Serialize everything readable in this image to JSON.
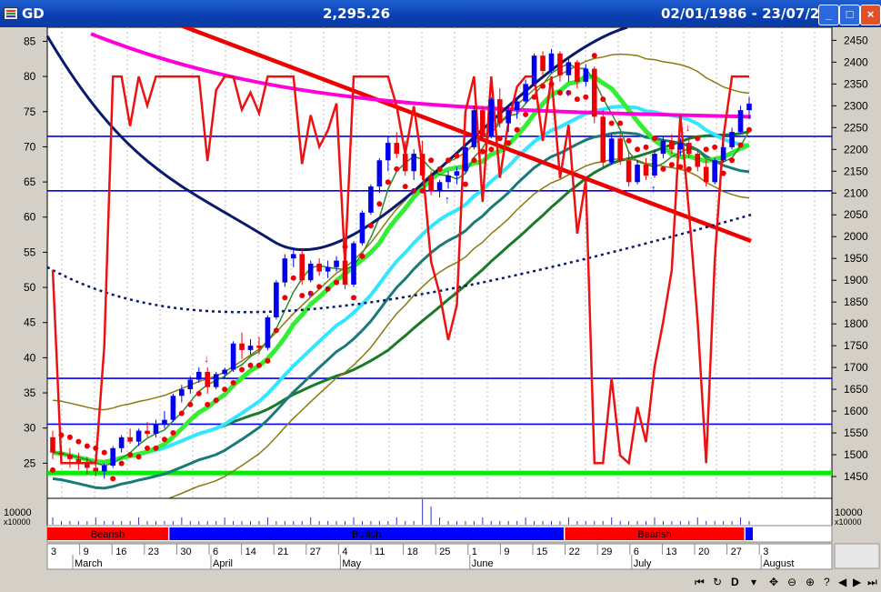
{
  "window": {
    "symbol": "GD",
    "last_value": "2,295.26",
    "date_range": "02/01/1986 - 23/07/2009",
    "controls": [
      "_",
      "□",
      "×"
    ]
  },
  "chart_data": {
    "type": "candlestick",
    "ylim_left": [
      20,
      87
    ],
    "ylim_right": [
      1400,
      2480
    ],
    "left_ticks": [
      "85",
      "80",
      "75",
      "70",
      "65",
      "60",
      "55",
      "50",
      "45",
      "40",
      "35",
      "30",
      "25"
    ],
    "right_ticks": [
      "2450",
      "2400",
      "2350",
      "2300",
      "2250",
      "2200",
      "2150",
      "2100",
      "2050",
      "2000",
      "1950",
      "1900",
      "1850",
      "1800",
      "1750",
      "1700",
      "1650",
      "1600",
      "1550",
      "1500",
      "1450"
    ],
    "volume": {
      "left_label": "10000",
      "right_label": "10000",
      "unit_label": "x10000"
    },
    "regime_bar": [
      {
        "label": "Bearish",
        "color": "#ff0000",
        "from_bar": 0,
        "to_bar": 14
      },
      {
        "label": "Bullish",
        "color": "#0000ff",
        "from_bar": 14,
        "to_bar": 60
      },
      {
        "label": "Bearish",
        "color": "#ff0000",
        "from_bar": 60,
        "to_bar": 81
      },
      {
        "label": "",
        "color": "#0000ff",
        "from_bar": 81,
        "to_bar": 82
      }
    ],
    "x_days": [
      "3",
      "9",
      "16",
      "23",
      "30",
      "6",
      "14",
      "21",
      "27",
      "4",
      "11",
      "18",
      "25",
      "1",
      "9",
      "15",
      "22",
      "29",
      "6",
      "13",
      "20",
      "27",
      "3"
    ],
    "months": [
      "March",
      "April",
      "May",
      "June",
      "July",
      "August"
    ],
    "first_day_label": "3",
    "horizontal_lines": [
      {
        "right_value": 2230,
        "color": "#0000ff"
      },
      {
        "right_value": 2105,
        "color": "#0000ff"
      },
      {
        "right_value": 1675,
        "color": "#0000ff"
      },
      {
        "right_value": 1570,
        "color": "#0000ff"
      },
      {
        "right_value": 1458,
        "color": "#00ee00"
      }
    ],
    "candles_right_axis": [
      [
        1540,
        1555,
        1490,
        1505
      ],
      [
        1505,
        1520,
        1480,
        1500
      ],
      [
        1500,
        1515,
        1470,
        1490
      ],
      [
        1490,
        1505,
        1465,
        1480
      ],
      [
        1480,
        1495,
        1455,
        1470
      ],
      [
        1470,
        1490,
        1450,
        1462
      ],
      [
        1462,
        1480,
        1445,
        1475
      ],
      [
        1475,
        1520,
        1470,
        1515
      ],
      [
        1515,
        1545,
        1505,
        1540
      ],
      [
        1540,
        1560,
        1525,
        1530
      ],
      [
        1530,
        1560,
        1520,
        1555
      ],
      [
        1555,
        1575,
        1540,
        1548
      ],
      [
        1548,
        1580,
        1540,
        1570
      ],
      [
        1570,
        1600,
        1560,
        1580
      ],
      [
        1580,
        1640,
        1575,
        1635
      ],
      [
        1635,
        1660,
        1620,
        1650
      ],
      [
        1650,
        1680,
        1640,
        1672
      ],
      [
        1672,
        1700,
        1665,
        1690
      ],
      [
        1690,
        1700,
        1640,
        1655
      ],
      [
        1655,
        1690,
        1650,
        1685
      ],
      [
        1685,
        1700,
        1675,
        1695
      ],
      [
        1695,
        1760,
        1690,
        1755
      ],
      [
        1755,
        1780,
        1720,
        1740
      ],
      [
        1740,
        1765,
        1730,
        1750
      ],
      [
        1750,
        1770,
        1730,
        1745
      ],
      [
        1745,
        1820,
        1740,
        1815
      ],
      [
        1815,
        1900,
        1810,
        1895
      ],
      [
        1895,
        1960,
        1885,
        1950
      ],
      [
        1950,
        1975,
        1930,
        1960
      ],
      [
        1960,
        1970,
        1890,
        1900
      ],
      [
        1900,
        1945,
        1895,
        1938
      ],
      [
        1938,
        1950,
        1910,
        1920
      ],
      [
        1920,
        1945,
        1905,
        1930
      ],
      [
        1930,
        1955,
        1920,
        1945
      ],
      [
        1945,
        1952,
        1880,
        1890
      ],
      [
        1890,
        1990,
        1885,
        1985
      ],
      [
        1985,
        2060,
        1980,
        2055
      ],
      [
        2055,
        2120,
        2050,
        2115
      ],
      [
        2115,
        2180,
        2100,
        2175
      ],
      [
        2175,
        2230,
        2150,
        2215
      ],
      [
        2215,
        2240,
        2180,
        2190
      ],
      [
        2190,
        2220,
        2140,
        2150
      ],
      [
        2150,
        2200,
        2130,
        2190
      ],
      [
        2190,
        2220,
        2130,
        2140
      ],
      [
        2140,
        2150,
        2095,
        2105
      ],
      [
        2105,
        2130,
        2090,
        2125
      ],
      [
        2125,
        2150,
        2110,
        2140
      ],
      [
        2140,
        2160,
        2120,
        2150
      ],
      [
        2150,
        2210,
        2145,
        2205
      ],
      [
        2205,
        2300,
        2200,
        2290
      ],
      [
        2290,
        2300,
        2220,
        2230
      ],
      [
        2230,
        2320,
        2225,
        2315
      ],
      [
        2315,
        2340,
        2250,
        2260
      ],
      [
        2260,
        2300,
        2240,
        2290
      ],
      [
        2290,
        2320,
        2270,
        2310
      ],
      [
        2310,
        2360,
        2305,
        2350
      ],
      [
        2350,
        2420,
        2345,
        2415
      ],
      [
        2415,
        2425,
        2370,
        2380
      ],
      [
        2380,
        2430,
        2375,
        2420
      ],
      [
        2420,
        2425,
        2355,
        2370
      ],
      [
        2370,
        2410,
        2355,
        2400
      ],
      [
        2400,
        2405,
        2340,
        2355
      ],
      [
        2355,
        2395,
        2345,
        2385
      ],
      [
        2385,
        2390,
        2260,
        2275
      ],
      [
        2275,
        2290,
        2160,
        2170
      ],
      [
        2170,
        2235,
        2165,
        2225
      ],
      [
        2225,
        2235,
        2165,
        2175
      ],
      [
        2175,
        2195,
        2115,
        2125
      ],
      [
        2125,
        2175,
        2120,
        2165
      ],
      [
        2165,
        2180,
        2130,
        2140
      ],
      [
        2140,
        2200,
        2135,
        2190
      ],
      [
        2190,
        2230,
        2180,
        2220
      ],
      [
        2220,
        2235,
        2190,
        2200
      ],
      [
        2200,
        2225,
        2185,
        2215
      ],
      [
        2215,
        2230,
        2180,
        2190
      ],
      [
        2190,
        2200,
        2150,
        2160
      ],
      [
        2160,
        2175,
        2115,
        2125
      ],
      [
        2125,
        2180,
        2120,
        2175
      ],
      [
        2175,
        2215,
        2170,
        2205
      ],
      [
        2205,
        2250,
        2200,
        2240
      ],
      [
        2240,
        2300,
        2235,
        2290
      ],
      [
        2290,
        2320,
        2270,
        2305
      ]
    ]
  }
}
